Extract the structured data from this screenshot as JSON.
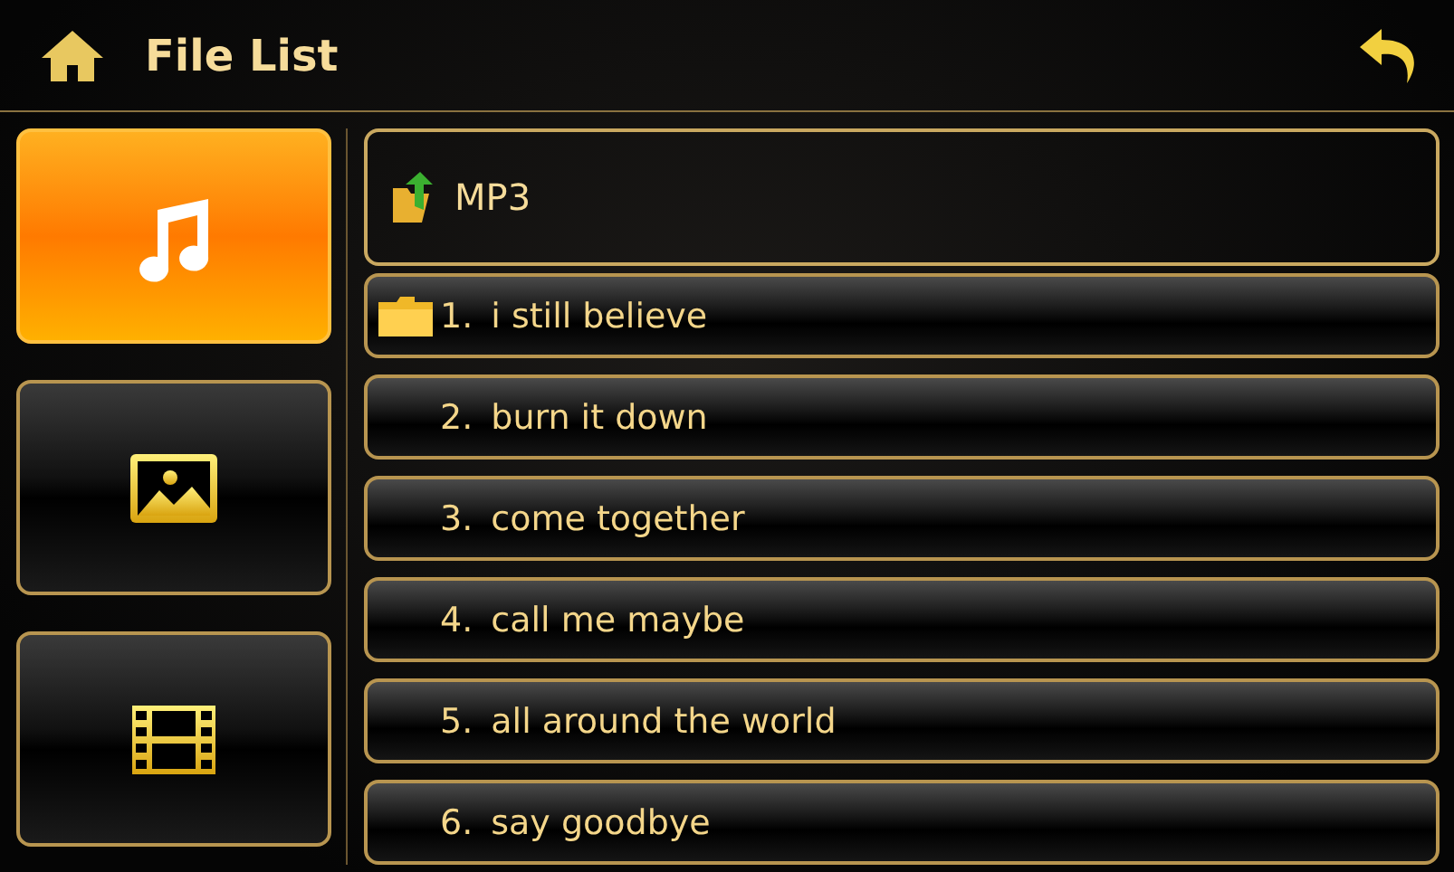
{
  "header": {
    "title": "File List"
  },
  "categories": [
    {
      "kind": "music",
      "selected": true
    },
    {
      "kind": "image",
      "selected": false
    },
    {
      "kind": "video",
      "selected": false
    }
  ],
  "folder": {
    "name": "MP3"
  },
  "files": [
    {
      "kind": "folder",
      "number": "1.",
      "title": "i still believe"
    },
    {
      "kind": "file",
      "number": "2.",
      "title": "burn it down"
    },
    {
      "kind": "file",
      "number": "3.",
      "title": "come together"
    },
    {
      "kind": "file",
      "number": "4.",
      "title": "call me maybe"
    },
    {
      "kind": "file",
      "number": "5.",
      "title": "all around the world"
    },
    {
      "kind": "file",
      "number": "6.",
      "title": "say goodbye"
    }
  ]
}
